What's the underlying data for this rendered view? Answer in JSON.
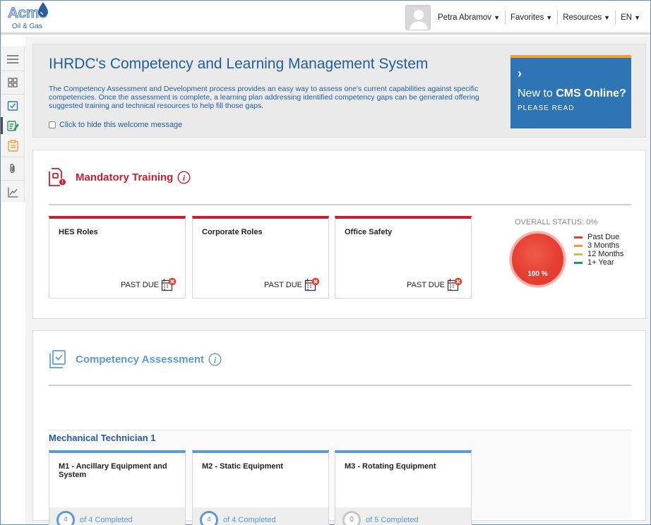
{
  "brand": {
    "name": "Acme",
    "sub": "Oil & Gas"
  },
  "header": {
    "user_name": "Petra Abramov",
    "favorites": "Favorites",
    "resources": "Resources",
    "language": "EN"
  },
  "sidebar": {
    "items": [
      {
        "icon": "menu-icon"
      },
      {
        "icon": "dashboard-icon"
      },
      {
        "icon": "checklist-icon"
      },
      {
        "icon": "edit-list-icon"
      },
      {
        "icon": "clipboard-icon"
      },
      {
        "icon": "paperclip-icon"
      },
      {
        "icon": "chart-icon"
      }
    ]
  },
  "welcome": {
    "title": "IHRDC's Competency and Learning Management System",
    "description": "The Competency Assessment and Development process provides an easy way to assess one's current capabilities against specific competencies. Once the assessment is complete, a learning plan addressing identified competency gaps can be generated offering suggested training and technical resources to help fill those gaps.",
    "hide_label": "Click to hide this welcome message",
    "promo": {
      "line1": "New to",
      "line1_bold": "CMS Online?",
      "line2": "PLEASE READ"
    }
  },
  "mandatory_training": {
    "title": "Mandatory Training",
    "cards": [
      {
        "title": "HES Roles",
        "status": "PAST DUE"
      },
      {
        "title": "Corporate Roles",
        "status": "PAST DUE"
      },
      {
        "title": "Office Safety",
        "status": "PAST DUE"
      }
    ],
    "overall_status": "OVERALL STATUS: 0%",
    "circle_label": "100 %",
    "legend": [
      {
        "label": "Past Due",
        "color": "#e8412f"
      },
      {
        "label": "3 Months",
        "color": "#f29a2e"
      },
      {
        "label": "12 Months",
        "color": "#c9c34a"
      },
      {
        "label": "1+ Year",
        "color": "#1a9e6e"
      }
    ]
  },
  "competency_assessment": {
    "title": "Competency Assessment",
    "group": "Mechanical Technician 1",
    "cards": [
      {
        "title": "M1 - Ancillary Equipment and System",
        "count": "4",
        "text": "of 4 Completed",
        "done": true
      },
      {
        "title": "M2 - Static Equipment",
        "count": "4",
        "text": "of 4 Completed",
        "done": true
      },
      {
        "title": "M3 - Rotating Equipment",
        "count": "0",
        "text": "of 5 Completed",
        "done": false
      }
    ]
  },
  "colors": {
    "accent": "#1f5fa0",
    "red": "#cc1f2e",
    "blue": "#5b9bd5",
    "promo": "#2e75b6"
  }
}
